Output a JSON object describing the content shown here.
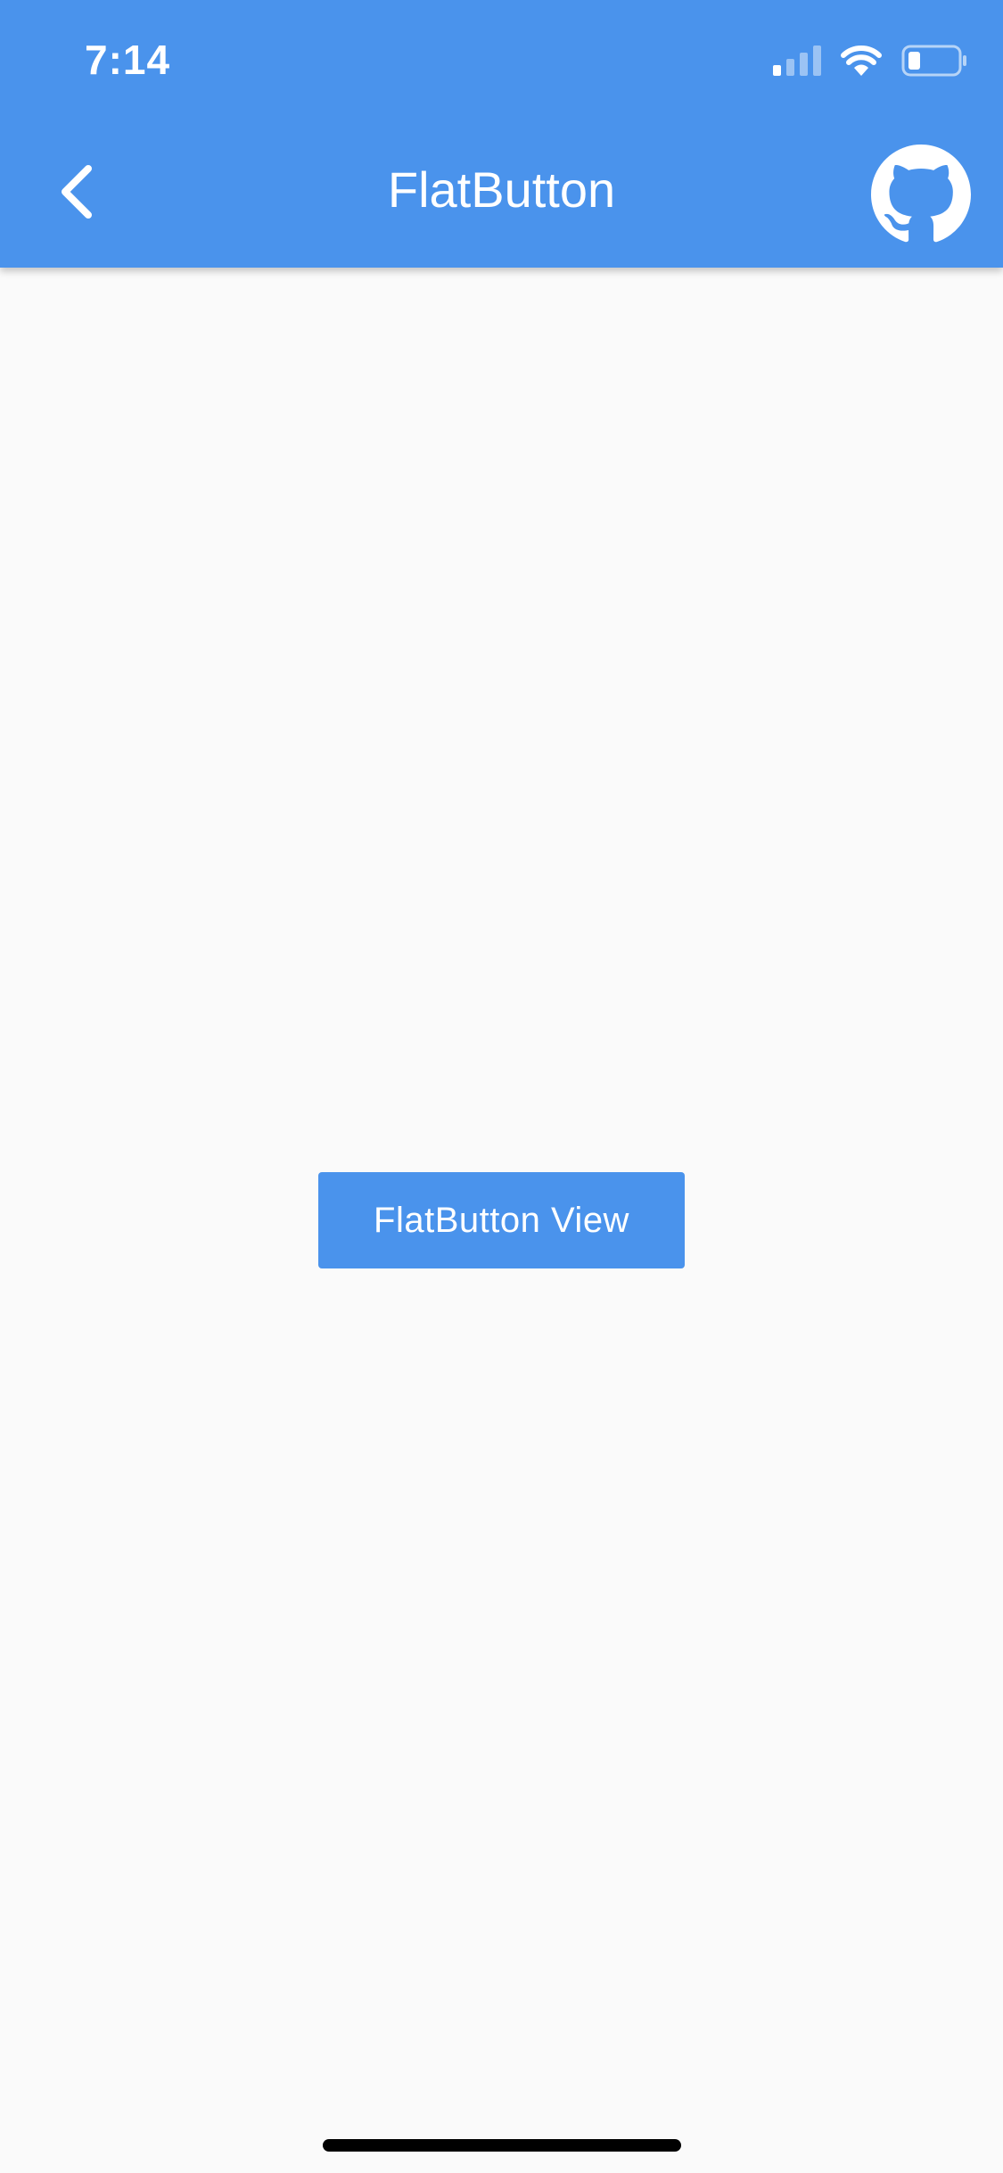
{
  "status_bar": {
    "time": "7:14",
    "icons": [
      "cellular-signal-icon",
      "wifi-icon",
      "battery-icon"
    ],
    "battery_level": 0.2
  },
  "app_bar": {
    "title": "FlatButton",
    "back_icon": "chevron-left-icon",
    "action_icon": "github-icon"
  },
  "main": {
    "button_label": "FlatButton View"
  },
  "colors": {
    "primary": "#4a93ec",
    "background": "#fafafa",
    "on_primary": "#ffffff"
  }
}
